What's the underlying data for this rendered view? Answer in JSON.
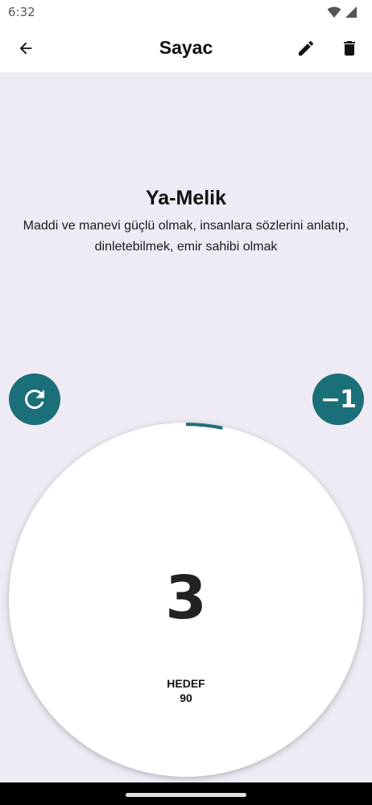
{
  "status_bar": {
    "time": "6:32",
    "icons": [
      "wifi-icon",
      "signal-icon"
    ]
  },
  "app_bar": {
    "title": "Sayac",
    "icons": [
      "back-arrow-icon",
      "pencil-icon",
      "trash-icon"
    ]
  },
  "dhikr": {
    "title": "Ya-Melik",
    "description": "Maddi ve manevi güçlü olmak, insanlara sözlerini anlatıp, dinletebilmek, emir sahibi olmak"
  },
  "controls": {
    "reset_icon": "refresh-icon",
    "decrement_label": "−1"
  },
  "counter": {
    "count": "3",
    "count_number": 3,
    "target_label": "HEDEF",
    "target_value": "90",
    "target_number": 90
  },
  "colors": {
    "accent": "#1b6f78",
    "background": "#efebf5",
    "surface": "#ffffff"
  }
}
